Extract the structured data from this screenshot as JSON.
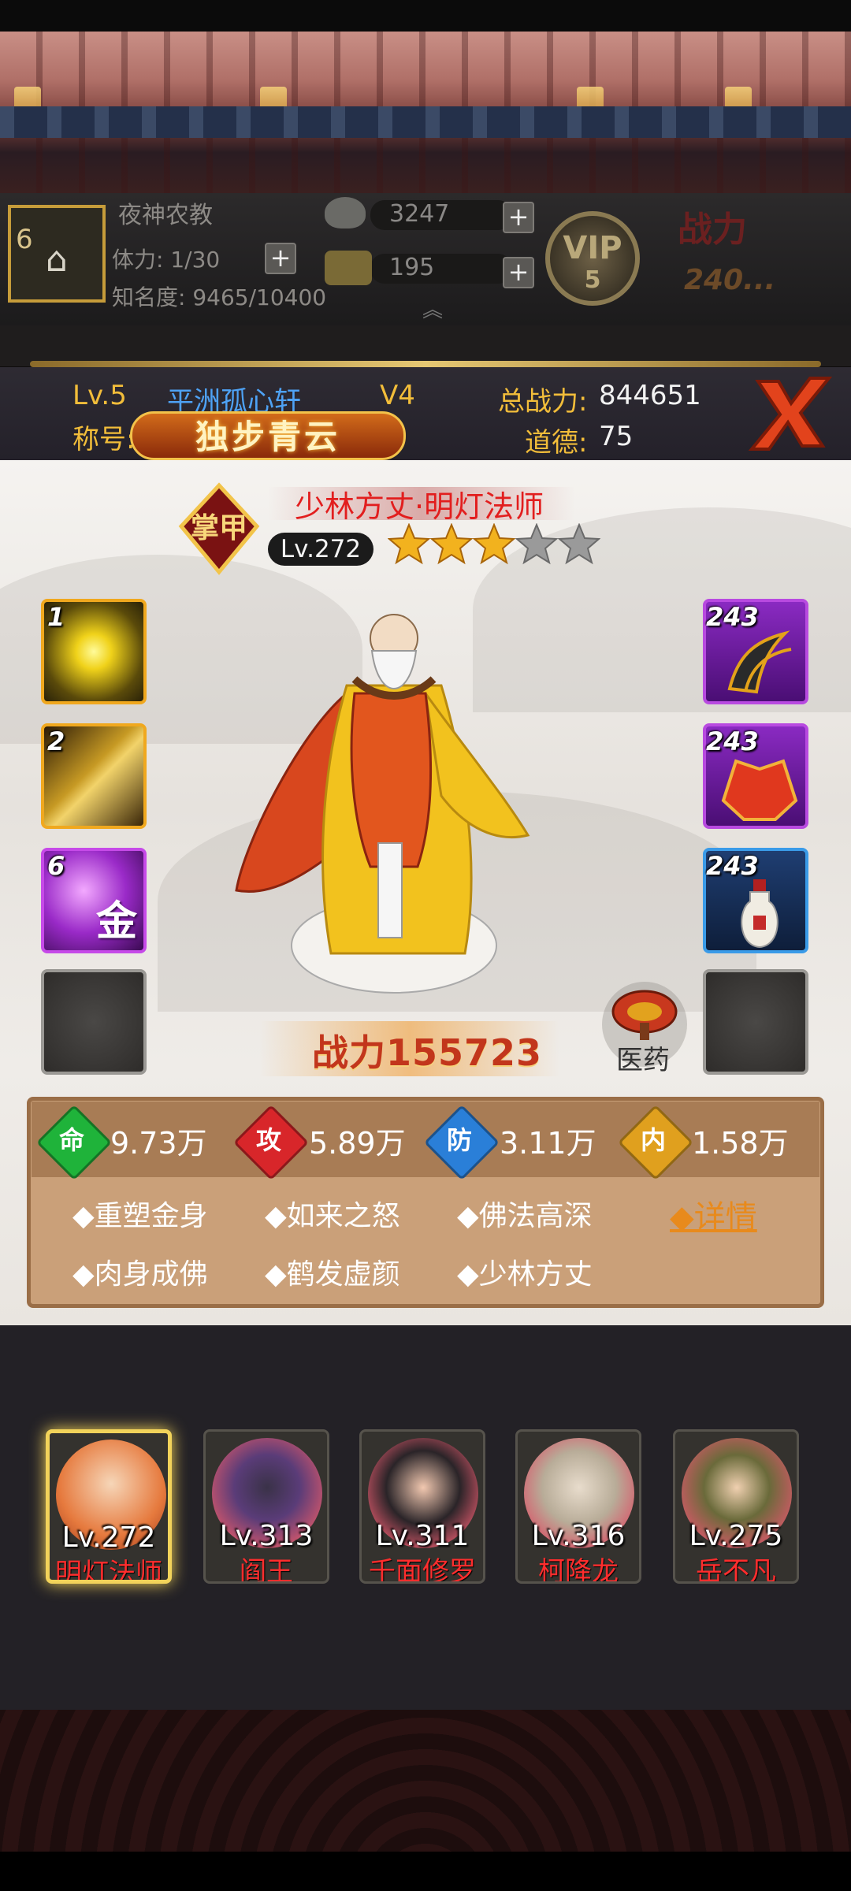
{
  "player": {
    "name": "夜神农教",
    "level_badge": "6",
    "stamina_label": "体力: 1/30",
    "fame_label": "知名度: 9465/10400",
    "silver": "3247",
    "gold": "195",
    "vip_text": "VIP",
    "vip_level": "5",
    "power_title": "战力",
    "power_value": "240..."
  },
  "info": {
    "level": "Lv.5",
    "server": "平洲孤心轩",
    "vip": "V4",
    "total_power_label": "总战力:",
    "total_power_value": "844651",
    "title_label": "称号:",
    "title_badge": "独步青云",
    "morality_label": "道德:",
    "morality_value": "75"
  },
  "hero": {
    "rank_glyph": "掌甲",
    "name": "少林方丈·明灯法师",
    "level": "Lv.272",
    "stars": 3,
    "max_stars": 5,
    "power_text": "战力155723",
    "medicine_label": "医药"
  },
  "skills": [
    {
      "num": "1"
    },
    {
      "num": "2"
    },
    {
      "num": "6",
      "glyph": "金"
    },
    {
      "num": ""
    }
  ],
  "equipment": [
    {
      "num": "243"
    },
    {
      "num": "243"
    },
    {
      "num": "243"
    },
    {
      "num": ""
    }
  ],
  "stats": [
    {
      "icon": "命",
      "value": "9.73万",
      "color": "#1fb33a"
    },
    {
      "icon": "攻",
      "value": "5.89万",
      "color": "#d8262a"
    },
    {
      "icon": "防",
      "value": "3.11万",
      "color": "#2a7fd8"
    },
    {
      "icon": "内",
      "value": "1.58万",
      "color": "#e0a01e"
    }
  ],
  "traits": [
    "◆重塑金身",
    "◆如来之怒",
    "◆佛法高深",
    "◆肉身成佛",
    "◆鹤发虚颜",
    "◆少林方丈"
  ],
  "detail_label": "◆详情",
  "team": [
    {
      "level": "Lv.272",
      "name": "明灯法师",
      "selected": true
    },
    {
      "level": "Lv.313",
      "name": "阎王"
    },
    {
      "level": "Lv.311",
      "name": "千面修罗"
    },
    {
      "level": "Lv.316",
      "name": "柯降龙"
    },
    {
      "level": "Lv.275",
      "name": "岳不凡"
    }
  ]
}
